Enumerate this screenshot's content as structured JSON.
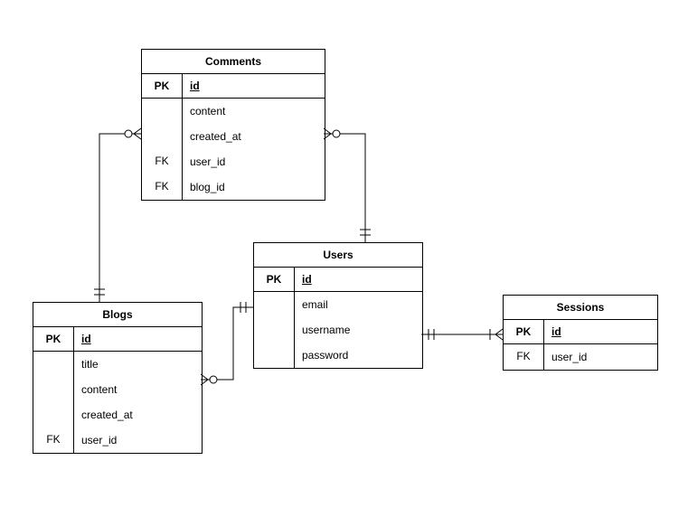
{
  "diagram": {
    "type": "er-diagram",
    "entities": {
      "comments": {
        "title": "Comments",
        "pk_label": "PK",
        "pk_field": "id",
        "attrs": [
          {
            "key": "",
            "name": "content"
          },
          {
            "key": "",
            "name": "created_at"
          },
          {
            "key": "FK",
            "name": "user_id"
          },
          {
            "key": "FK",
            "name": "blog_id"
          }
        ]
      },
      "users": {
        "title": "Users",
        "pk_label": "PK",
        "pk_field": "id",
        "attrs": [
          {
            "key": "",
            "name": "email"
          },
          {
            "key": "",
            "name": "username"
          },
          {
            "key": "",
            "name": "password"
          }
        ]
      },
      "blogs": {
        "title": "Blogs",
        "pk_label": "PK",
        "pk_field": "id",
        "attrs": [
          {
            "key": "",
            "name": "title"
          },
          {
            "key": "",
            "name": "content"
          },
          {
            "key": "",
            "name": "created_at"
          },
          {
            "key": "FK",
            "name": "user_id"
          }
        ]
      },
      "sessions": {
        "title": "Sessions",
        "pk_label": "PK",
        "pk_field": "id",
        "attrs": [
          {
            "key": "FK",
            "name": "user_id"
          }
        ]
      }
    },
    "relationships": [
      {
        "from": "Comments.blog_id",
        "to": "Blogs.id",
        "cardinality": "many-to-one"
      },
      {
        "from": "Comments.user_id",
        "to": "Users.id",
        "cardinality": "many-to-one"
      },
      {
        "from": "Blogs.user_id",
        "to": "Users.id",
        "cardinality": "many-to-one"
      },
      {
        "from": "Sessions.user_id",
        "to": "Users.id",
        "cardinality": "many-to-one"
      }
    ]
  }
}
